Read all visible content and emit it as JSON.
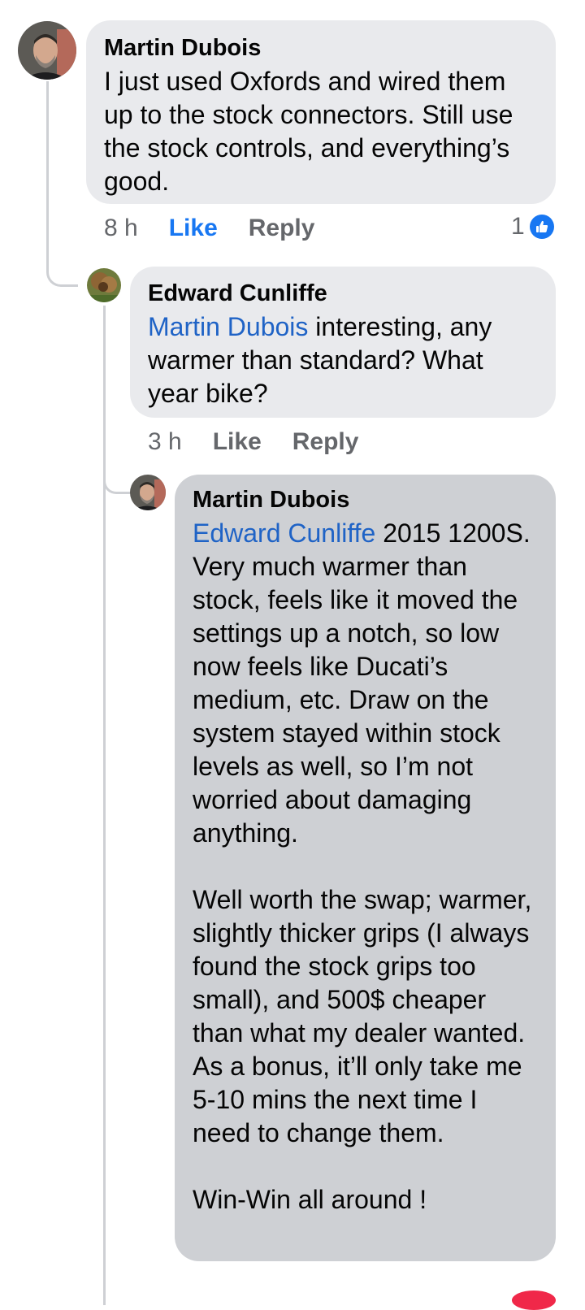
{
  "comments": [
    {
      "author": "Martin Dubois",
      "text": "I just used Oxfords and wired them up to the stock connectors.  Still use the stock controls, and everything’s good.",
      "time": "8 h",
      "like_label": "Like",
      "reply_label": "Reply",
      "reaction_count": "1",
      "reaction_icon": "like-thumb-icon"
    },
    {
      "author": "Edward Cunliffe",
      "mention": "Martin Dubois",
      "text": " interesting, any warmer than standard? What year bike?",
      "time": "3 h",
      "like_label": "Like",
      "reply_label": "Reply"
    },
    {
      "author": "Martin Dubois",
      "mention": "Edward Cunliffe",
      "text": " 2015 1200S.  Very much warmer than stock, feels like it moved the settings up a notch, so low now feels like Ducati’s medium, etc.  Draw on the system stayed within stock levels as well, so I’m not worried about damaging anything.\n\nWell worth the swap; warmer, slightly thicker grips (I always found the stock grips too small), and 500$ cheaper than what my dealer wanted.  As a bonus, it’ll only take me 5-10 mins the next time I need to change them.\n\nWin-Win all around !"
    }
  ],
  "colors": {
    "bubble": "#e9eaed",
    "bubble_pressed": "#ced0d4",
    "mention": "#1f63c6",
    "like_active": "#1877f2",
    "meta": "#65676b"
  }
}
